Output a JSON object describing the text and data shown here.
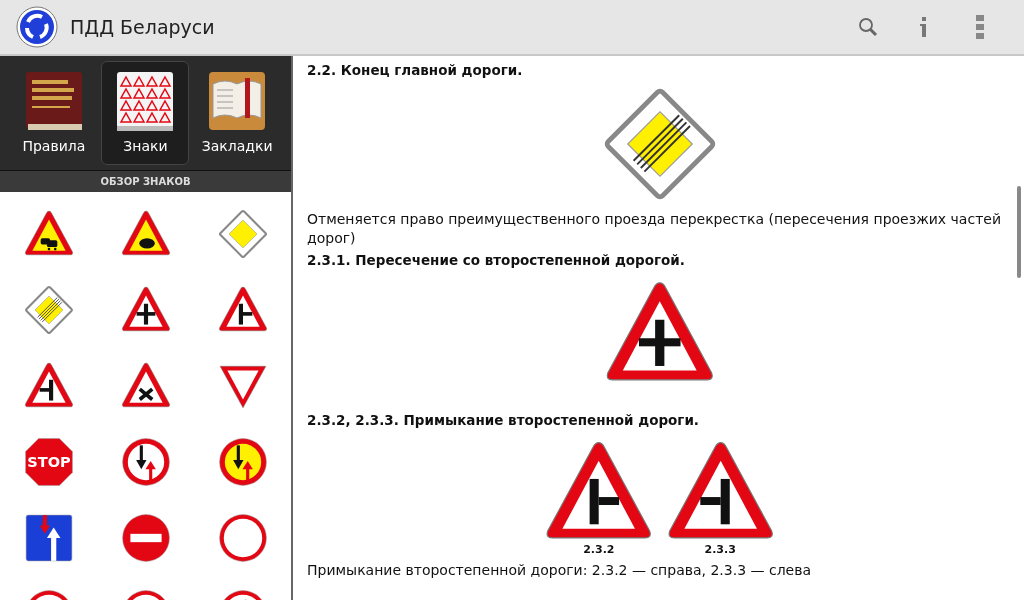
{
  "app_bar": {
    "title": "ПДД Беларуси"
  },
  "sections": [
    {
      "label": "Правила",
      "selected": false
    },
    {
      "label": "Знаки",
      "selected": true
    },
    {
      "label": "Закладки",
      "selected": false
    }
  ],
  "section_header": "ОБЗОР ЗНАКОВ",
  "stop_sign_text": "STOP",
  "content": [
    {
      "kind": "heading",
      "text": "2.2. Конец главной дороги."
    },
    {
      "kind": "figure"
    },
    {
      "kind": "paragraph",
      "text": "Отменяется право преимущественного проезда перекрестка (пересечения проезжих частей дорог)"
    },
    {
      "kind": "heading",
      "text": "2.3.1. Пересечение со второстепенной дорогой."
    },
    {
      "kind": "figure"
    },
    {
      "kind": "heading",
      "text": "2.3.2, 2.3.3. Примыкание второстепенной дороги."
    },
    {
      "kind": "figure",
      "captions": [
        "2.3.2",
        "2.3.3"
      ]
    },
    {
      "kind": "paragraph",
      "text": "Примыкание второстепенной дороги: 2.3.2 — справа, 2.3.3 — слева"
    }
  ]
}
